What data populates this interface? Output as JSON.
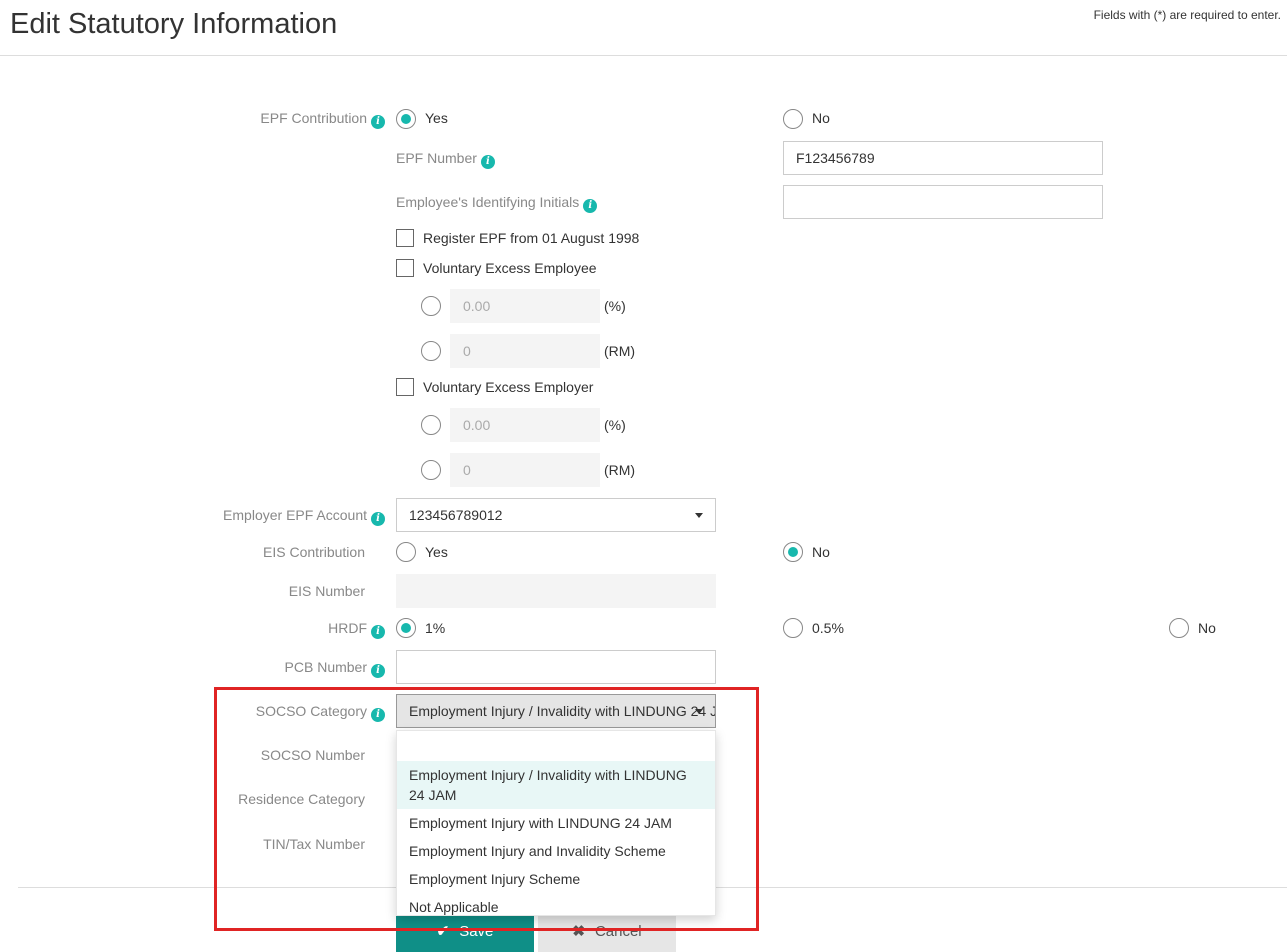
{
  "header": {
    "title": "Edit Statutory Information",
    "required_note": "Fields with (*) are required to enter."
  },
  "epf": {
    "label": "EPF Contribution",
    "yes": "Yes",
    "no": "No",
    "number_label": "EPF Number",
    "number_value": "F123456789",
    "initials_label": "Employee's Identifying Initials",
    "initials_value": "",
    "register_label": "Register EPF from 01 August 1998",
    "vol_employee_label": "Voluntary Excess Employee",
    "vol_employee_pct_placeholder": "0.00",
    "vol_employee_rm_placeholder": "0",
    "vol_employer_label": "Voluntary Excess Employer",
    "vol_employer_pct_placeholder": "0.00",
    "vol_employer_rm_placeholder": "0",
    "pct_unit": "(%)",
    "rm_unit": "(RM)"
  },
  "employer_epf": {
    "label": "Employer EPF Account",
    "value": "123456789012"
  },
  "eis": {
    "label": "EIS Contribution",
    "yes": "Yes",
    "no": "No",
    "number_label": "EIS Number",
    "number_value": ""
  },
  "hrdf": {
    "label": "HRDF",
    "opt1": "1%",
    "opt2": "0.5%",
    "opt3": "No"
  },
  "pcb": {
    "label": "PCB Number",
    "value": ""
  },
  "socso": {
    "label": "SOCSO Category",
    "selected": "Employment Injury / Invalidity with LINDUNG 24 JAM",
    "number_label": "SOCSO Number",
    "options": [
      "Employment Injury / Invalidity with LINDUNG 24 JAM",
      "Employment Injury with LINDUNG 24 JAM",
      "Employment Injury and Invalidity Scheme",
      "Employment Injury Scheme",
      "Not Applicable"
    ]
  },
  "residence": {
    "label": "Residence Category"
  },
  "tin": {
    "label": "TIN/Tax Number"
  },
  "actions": {
    "save": "Save",
    "cancel": "Cancel"
  },
  "colors": {
    "accent": "#17b8ad",
    "save_button": "#0f8f87",
    "highlight_box": "#e02424"
  }
}
